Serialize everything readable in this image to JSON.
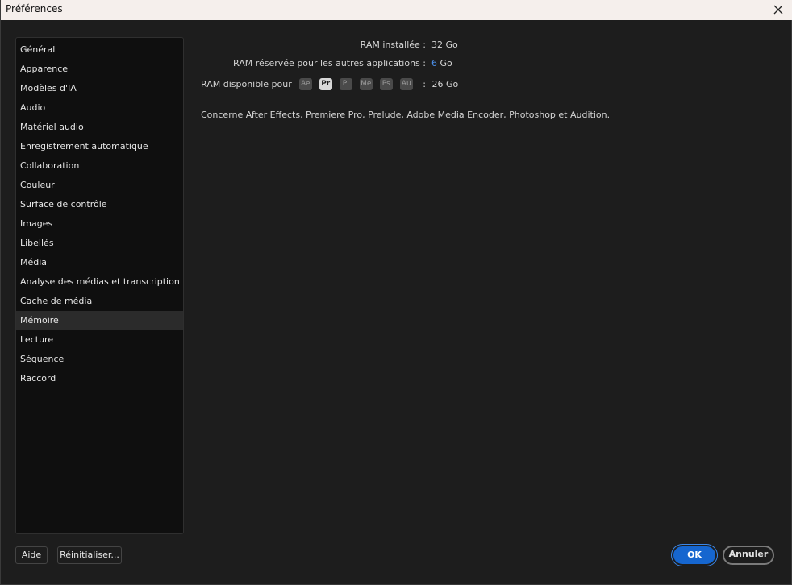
{
  "window": {
    "title": "Préférences"
  },
  "sidebar": {
    "items": [
      {
        "label": "Général"
      },
      {
        "label": "Apparence"
      },
      {
        "label": "Modèles d'IA"
      },
      {
        "label": "Audio"
      },
      {
        "label": "Matériel audio"
      },
      {
        "label": "Enregistrement automatique"
      },
      {
        "label": "Collaboration"
      },
      {
        "label": "Couleur"
      },
      {
        "label": "Surface de contrôle"
      },
      {
        "label": "Images"
      },
      {
        "label": "Libellés"
      },
      {
        "label": "Média"
      },
      {
        "label": "Analyse des médias et transcription"
      },
      {
        "label": "Cache de média"
      },
      {
        "label": "Mémoire"
      },
      {
        "label": "Lecture"
      },
      {
        "label": "Séquence"
      },
      {
        "label": "Raccord"
      }
    ],
    "selected": "Mémoire"
  },
  "memory": {
    "installed_label": "RAM installée :",
    "installed_value": "32 Go",
    "reserved_label": "RAM réservée pour les autres applications :",
    "reserved_value": "6",
    "reserved_unit": "Go",
    "available_label": "RAM disponible pour",
    "apps": [
      {
        "abbr": "Ae",
        "active": false
      },
      {
        "abbr": "Pr",
        "active": true
      },
      {
        "abbr": "Pl",
        "active": false
      },
      {
        "abbr": "Me",
        "active": false
      },
      {
        "abbr": "Ps",
        "active": false
      },
      {
        "abbr": "Au",
        "active": false
      }
    ],
    "available_separator": ":",
    "available_value": "26 Go",
    "note": "Concerne After Effects, Premiere Pro, Prelude, Adobe Media Encoder, Photoshop et Audition."
  },
  "footer": {
    "help_label": "Aide",
    "reset_label": "Réinitialiser...",
    "ok_label": "OK",
    "cancel_label": "Annuler"
  },
  "colors": {
    "accent": "#1666cf",
    "reserved_value": "#4b8fe8"
  }
}
